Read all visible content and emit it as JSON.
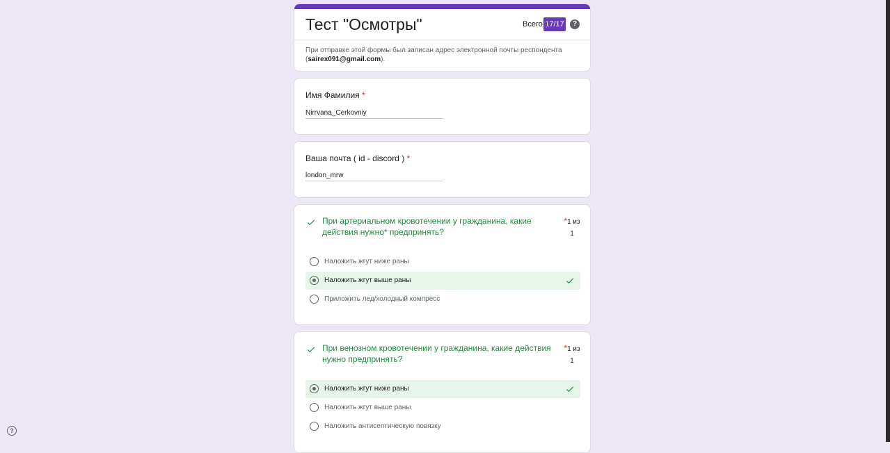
{
  "form": {
    "title": "Тест \"Осмотры\"",
    "score_label": "Всего",
    "score_value": "17/17",
    "help_glyph": "?",
    "email_note_prefix": "При отправке этой формы был записан адрес электронной почты респондента (",
    "email": "sairex091@gmail.com",
    "email_note_suffix": ").",
    "accent_color": "#673ab7"
  },
  "fields": [
    {
      "label": "Имя Фамилия",
      "required_mark": "*",
      "value": "Nirrvana_Cerkovniy"
    },
    {
      "label": "Ваша почта ( id - discord  )",
      "required_mark": "*",
      "value": "london_mrw"
    }
  ],
  "questions": [
    {
      "title": "При артериальном кровотечении у гражданина, какие действия нужно* предпринять?",
      "required_mark": "*",
      "points_line1": "1 из",
      "points_line2": "1",
      "options": [
        {
          "label": "Наложить жгут ниже раны",
          "selected": false,
          "correct": false
        },
        {
          "label": "Наложить жгут выше раны",
          "selected": true,
          "correct": true
        },
        {
          "label": "Приложить лед/холодный компресс",
          "selected": false,
          "correct": false
        }
      ]
    },
    {
      "title": "При венозном кровотечении у гражданина, какие действия нужно предпринять?",
      "required_mark": "*",
      "points_line1": "1 из",
      "points_line2": "1",
      "options": [
        {
          "label": "Наложить жгут ниже раны",
          "selected": true,
          "correct": true
        },
        {
          "label": "Наложить жгут выше раны",
          "selected": false,
          "correct": false
        },
        {
          "label": "Наложить антисептическую повязку",
          "selected": false,
          "correct": false
        }
      ]
    }
  ],
  "icons": {
    "correct": "check-icon",
    "help": "help-circle-icon"
  },
  "colors": {
    "correct_text": "#1e8e3e",
    "correct_bg": "#e6f4ea",
    "required": "#d93025",
    "page_bg": "#ede7f6"
  }
}
